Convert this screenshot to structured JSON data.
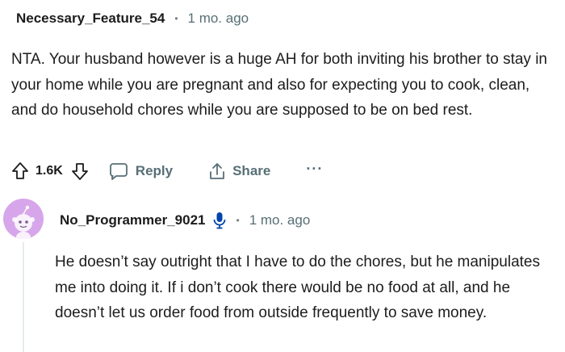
{
  "comments": [
    {
      "username": "Necessary_Feature_54",
      "separator": "•",
      "timestamp": "1 mo. ago",
      "body": "NTA. Your husband however is a huge AH for both inviting his brother to stay in your home while you are pregnant and also for expecting you to cook, clean, and do household chores while you are supposed to be on bed rest.",
      "actions": {
        "upvote_icon": "arrow-up-icon",
        "vote_count": "1.6K",
        "downvote_icon": "arrow-down-icon",
        "reply_label": "Reply",
        "share_label": "Share",
        "more_label": "···"
      }
    },
    {
      "username": "No_Programmer_9021",
      "badge_icon": "microphone-icon",
      "separator": "•",
      "timestamp": "1 mo. ago",
      "body": "He doesn’t say outright that I have to do the chores, but he manipulates me into doing it. If i don’t cook there would be no food at all, and he doesn’t let us order food from outside frequently to save money."
    }
  ],
  "colors": {
    "text": "#1c1c1c",
    "muted": "#576f76",
    "avatar_bg": "#d7a6ea",
    "mic_blue": "#0045ac"
  }
}
